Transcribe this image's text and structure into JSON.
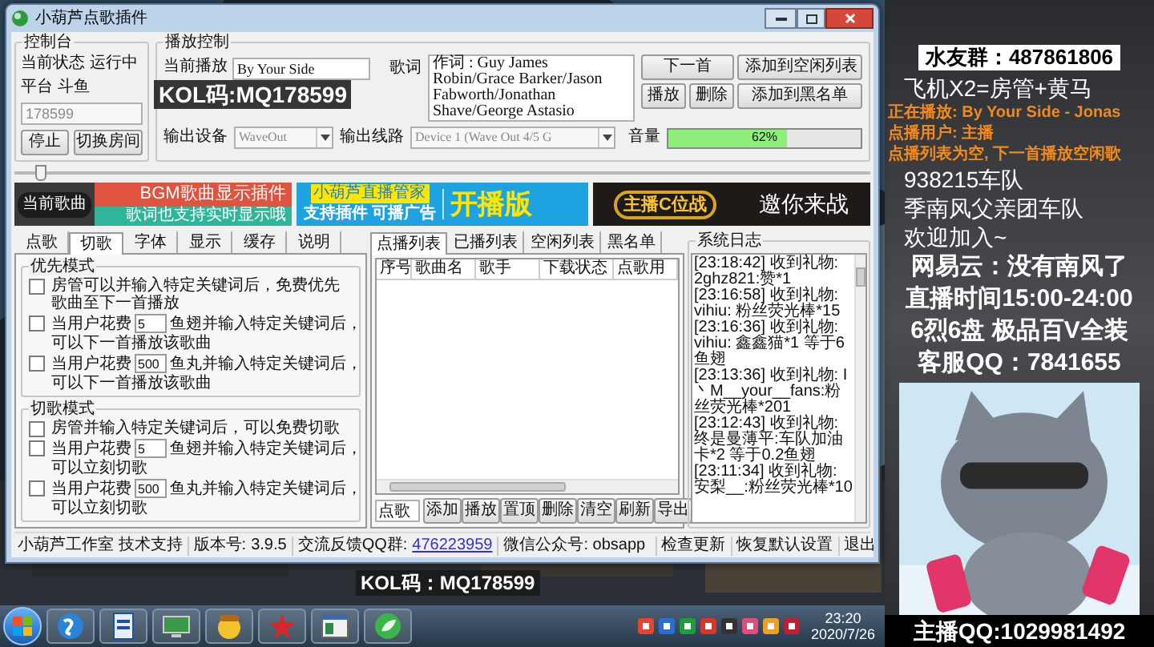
{
  "window": {
    "title": "小葫芦点歌插件"
  },
  "console": {
    "title": "控制台",
    "status_label": "当前状态",
    "status": "运行中",
    "platform": "平台 斗鱼",
    "room_id": "178599",
    "buttons": [
      "停止",
      "切换房间"
    ]
  },
  "playback": {
    "title": "播放控制",
    "current_label": "当前播放",
    "current": "By Your Side",
    "lyrics_label": "歌词",
    "lyrics": "作词 : Guy James Robin/Grace Barker/Jason Fabworth/Jonathan Shave/George Astasio",
    "output_device_label": "输出设备",
    "output_device": "WaveOut",
    "output_line_label": "输出线路",
    "output_line": "Device 1 (Wave Out 4/5 G",
    "volume_label": "音量",
    "volume": {
      "level": 0.62,
      "reading": "62%"
    },
    "buttons": [
      "下一首",
      "添加到空闲列表",
      "播放",
      "删除",
      "添加到黑名单"
    ]
  },
  "seek_slider": {
    "level": 0.03
  },
  "banners": [
    {
      "kind": "bgm",
      "tag": "当前歌曲",
      "title": "BGM歌曲显示插件",
      "subtitle": "歌词也支持实时显示哦"
    },
    {
      "kind": "manager",
      "title": "小葫芦直播管家",
      "subtitle": "支持插件 可播广告",
      "edition": "开播版"
    },
    {
      "kind": "battle",
      "title": "主播C位战",
      "subtitle": "邀你来战"
    }
  ],
  "settings_tabs": [
    {
      "label": "点歌",
      "selected": false
    },
    {
      "label": "切歌",
      "selected": true
    },
    {
      "label": "字体",
      "selected": false
    },
    {
      "label": "显示",
      "selected": false
    },
    {
      "label": "缓存",
      "selected": false
    },
    {
      "label": "说明",
      "selected": false
    }
  ],
  "priority_mode": {
    "title": "优先模式",
    "options": [
      {
        "kind": "plain",
        "checked": false,
        "text": "房管可以并输入特定关键词后，免费优先歌曲至下一首播放"
      },
      {
        "kind": "cost",
        "checked": false,
        "prefix": "当用户花费",
        "amount": "5",
        "suffix": "鱼翅并输入特定关键词后，",
        "result": "可以下一首播放该歌曲"
      },
      {
        "kind": "cost",
        "checked": false,
        "prefix": "当用户花费",
        "amount": "500",
        "suffix": "鱼丸并输入特定关键词后，",
        "result": "可以下一首播放该歌曲"
      }
    ]
  },
  "cut_mode": {
    "title": "切歌模式",
    "options": [
      {
        "kind": "plain",
        "checked": false,
        "text": "房管并输入特定关键词后，可以免费切歌"
      },
      {
        "kind": "cost",
        "checked": false,
        "prefix": "当用户花费",
        "amount": "5",
        "suffix": "鱼翅并输入特定关键词后，",
        "result": "可以立刻切歌"
      },
      {
        "kind": "cost",
        "checked": false,
        "prefix": "当用户花费",
        "amount": "500",
        "suffix": "鱼丸并输入特定关键词后，",
        "result": "可以立刻切歌"
      }
    ]
  },
  "list_tabs": [
    {
      "label": "点播列表",
      "selected": true
    },
    {
      "label": "已播列表",
      "selected": false
    },
    {
      "label": "空闲列表",
      "selected": false
    },
    {
      "label": "黑名单",
      "selected": false
    }
  ],
  "song_table": {
    "columns": [
      "序号",
      "歌曲名",
      "歌手",
      "下载状态",
      "点歌用"
    ]
  },
  "song_input": {
    "value": "点歌"
  },
  "list_buttons": [
    "添加",
    "播放",
    "置顶",
    "删除",
    "清空",
    "刷新",
    "导出"
  ],
  "system_log": {
    "title": "系统日志",
    "entries": [
      "[23:18:42] 收到礼物: 2ghz821:赞*1",
      "[23:16:58] 收到礼物: vihiu: 粉丝荧光棒*15",
      "[23:16:36] 收到礼物: vihiu: 鑫鑫猫*1 等于6鱼翅",
      "[23:13:36] 收到礼物: I丶M__your__fans:粉丝荧光棒*201",
      "[23:12:43] 收到礼物: 终是曼薄平:车队加油卡*2 等于0.2鱼翅",
      "[23:11:34] 收到礼物: 安梨__:粉丝荧光棒*10"
    ]
  },
  "status_bar": {
    "support": "小葫芦工作室 技术支持",
    "version_label": "版本号:",
    "version": "3.9.5",
    "qq_label": "交流反馈QQ群:",
    "qq_group": "476223959",
    "wechat": "微信公众号: obsapp",
    "actions": [
      "检查更新",
      "恢复默认设置",
      "退出"
    ]
  },
  "kol_codes": [
    "KOL码:MQ178599",
    "KOL码：MQ178599"
  ],
  "stream_panel": {
    "group": "水友群：487861806",
    "lines": [
      {
        "kind": "white",
        "text": "飞机X2=房管+黄马"
      },
      {
        "kind": "orange",
        "text": "正在播放: By Your Side - Jonas"
      },
      {
        "kind": "orange",
        "text": "点播用户: 主播"
      },
      {
        "kind": "orange",
        "text": "点播列表为空, 下一首播放空闲歌"
      },
      {
        "kind": "white",
        "text": "938215车队"
      },
      {
        "kind": "white",
        "text": "季南风父亲团车队"
      },
      {
        "kind": "white",
        "text": "欢迎加入~"
      },
      {
        "kind": "big",
        "text": "网易云：没有南风了"
      },
      {
        "kind": "big",
        "text": "直播时间15:00-24:00"
      },
      {
        "kind": "big",
        "text": "6烈6盘 极品百V全装"
      },
      {
        "kind": "big",
        "text": "客服QQ：7841655"
      }
    ],
    "host_qq": "主播QQ:1029981492"
  },
  "taskbar": {
    "time": "23:20",
    "date": "2020/7/26"
  }
}
